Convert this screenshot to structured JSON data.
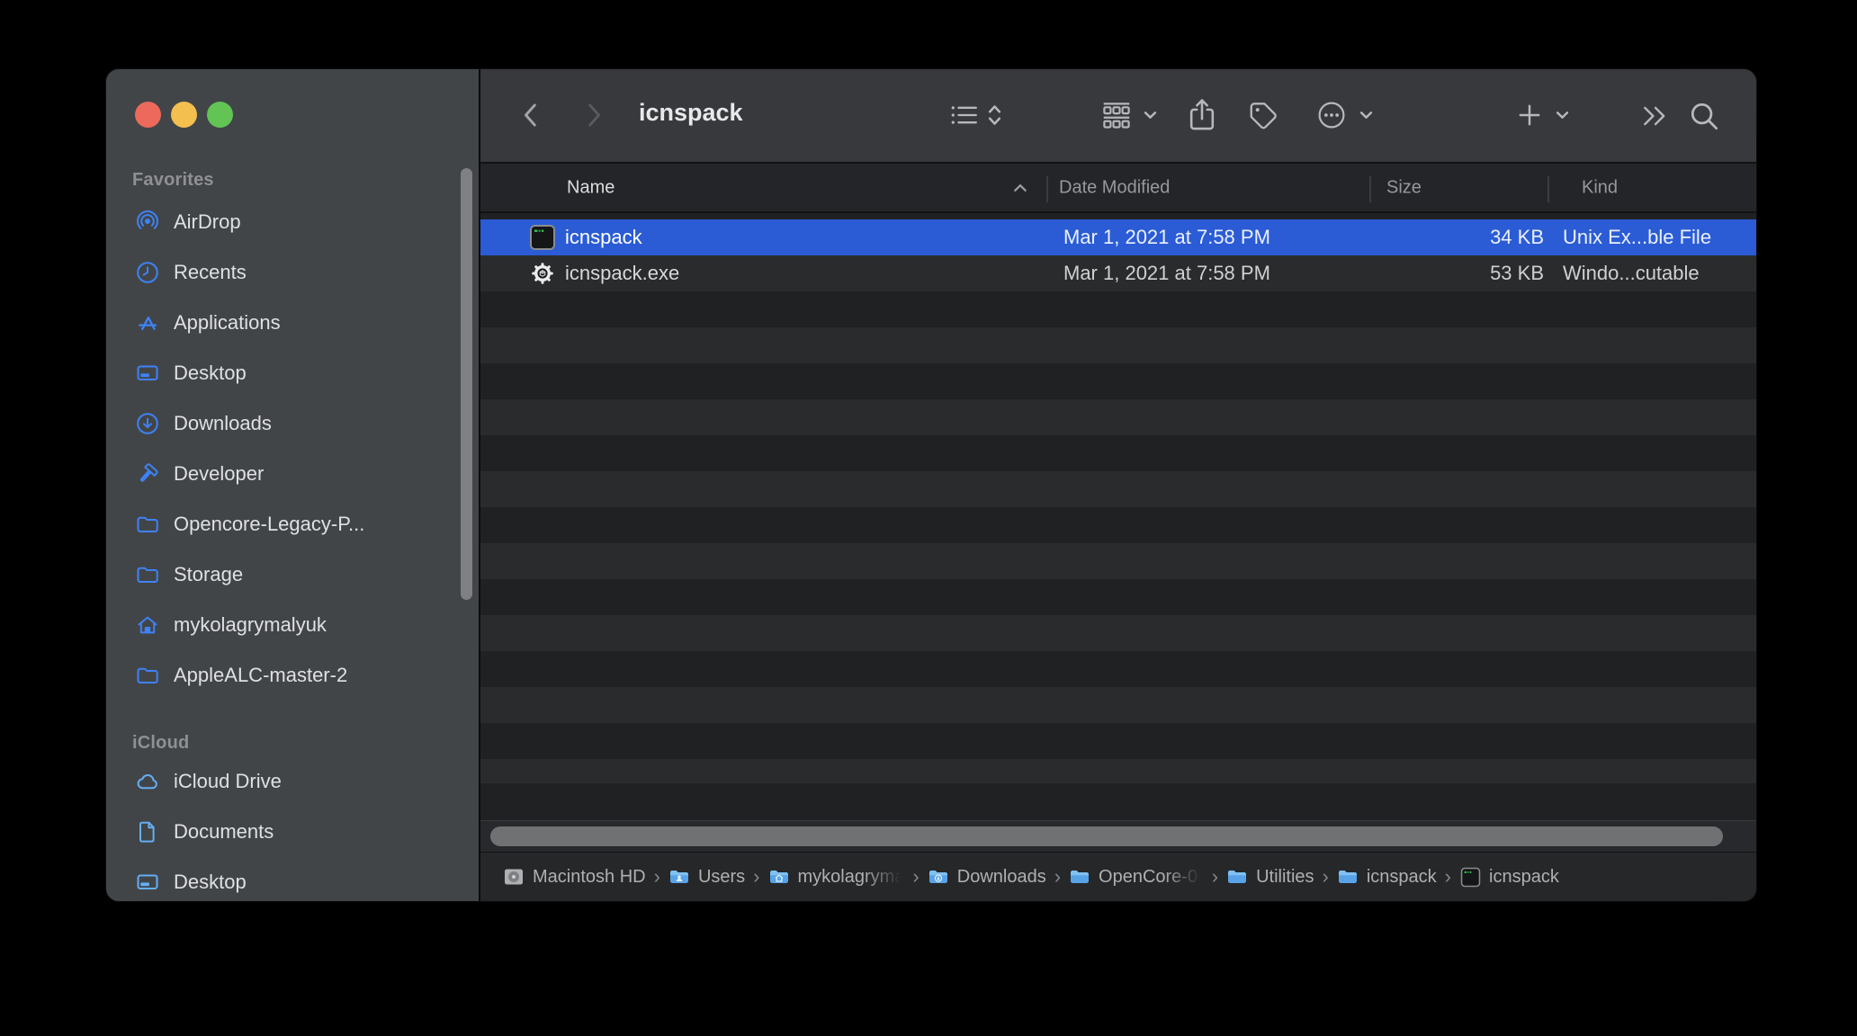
{
  "window": {
    "title": "icnspack"
  },
  "toolbar": {
    "icons": [
      "back",
      "forward",
      "list-view",
      "view-picker",
      "group-by",
      "share",
      "tag",
      "more-actions",
      "new-item",
      "show-more",
      "search"
    ]
  },
  "columns": {
    "name": "Name",
    "date_modified": "Date Modified",
    "size": "Size",
    "kind": "Kind",
    "sort_direction": "ascending"
  },
  "files": [
    {
      "name": "icnspack",
      "date_modified": "Mar 1, 2021 at 7:58 PM",
      "size": "34 KB",
      "kind": "Unix Ex...ble File",
      "icon": "terminal-executable-icon",
      "selected": true
    },
    {
      "name": "icnspack.exe",
      "date_modified": "Mar 1, 2021 at 7:58 PM",
      "size": "53 KB",
      "kind": "Windo...cutable",
      "icon": "gear-executable-icon",
      "selected": false
    }
  ],
  "sidebar": {
    "sections": [
      {
        "title": "Favorites",
        "items": [
          {
            "label": "AirDrop",
            "icon": "airdrop-icon"
          },
          {
            "label": "Recents",
            "icon": "clock-icon"
          },
          {
            "label": "Applications",
            "icon": "app-store-icon"
          },
          {
            "label": "Desktop",
            "icon": "desktop-icon"
          },
          {
            "label": "Downloads",
            "icon": "download-circle-icon"
          },
          {
            "label": "Developer",
            "icon": "hammer-icon"
          },
          {
            "label": "Opencore-Legacy-P...",
            "icon": "folder-icon"
          },
          {
            "label": "Storage",
            "icon": "folder-icon"
          },
          {
            "label": "mykolagrymalyuk",
            "icon": "home-icon"
          },
          {
            "label": "AppleALC-master-2",
            "icon": "folder-icon"
          }
        ]
      },
      {
        "title": "iCloud",
        "items": [
          {
            "label": "iCloud Drive",
            "icon": "cloud-icon"
          },
          {
            "label": "Documents",
            "icon": "document-icon"
          },
          {
            "label": "Desktop",
            "icon": "desktop-icon"
          }
        ]
      }
    ]
  },
  "path_bar": {
    "separator": "›",
    "items": [
      {
        "label": "Macintosh HD",
        "icon": "hard-drive-icon"
      },
      {
        "label": "Users",
        "icon": "folder-users-icon"
      },
      {
        "label": "mykolagryma",
        "icon": "folder-home-icon",
        "truncated": true
      },
      {
        "label": "Downloads",
        "icon": "folder-downloads-icon"
      },
      {
        "label": "OpenCore-0-",
        "icon": "folder-icon",
        "truncated": true
      },
      {
        "label": "Utilities",
        "icon": "folder-icon"
      },
      {
        "label": "icnspack",
        "icon": "folder-icon"
      },
      {
        "label": "icnspack",
        "icon": "terminal-executable-icon"
      }
    ]
  },
  "colors": {
    "selection_blue": "#2b5cd5",
    "sidebar_icon_blue": "#3d82f7",
    "icloud_icon_blue": "#64aef3",
    "traffic_red": "#ec695c",
    "traffic_yellow": "#f3bf4f",
    "traffic_green": "#61c454",
    "sidebar_bg": "#424548",
    "toolbar_bg": "#37393c",
    "row_stripe_dark": "#1f2123",
    "row_stripe_light": "#292b2d"
  }
}
